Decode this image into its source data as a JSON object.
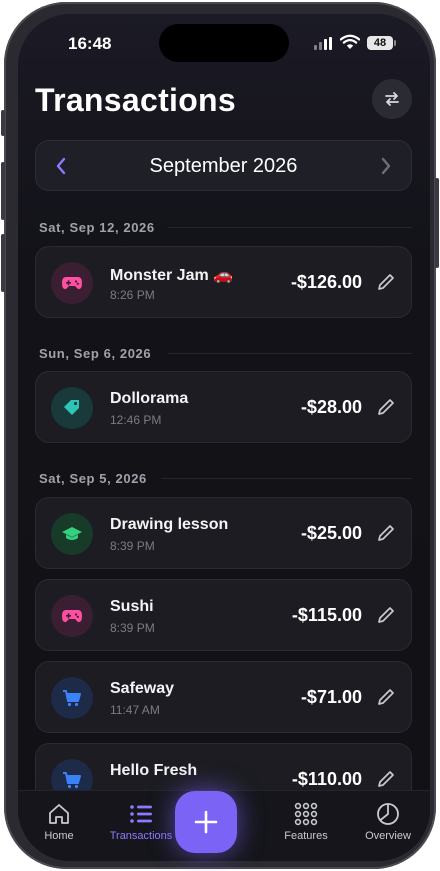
{
  "status": {
    "time": "16:48",
    "battery": "48"
  },
  "header": {
    "title": "Transactions"
  },
  "month_nav": {
    "label": "September 2026"
  },
  "groups": [
    {
      "date": "Sat, Sep 12, 2026",
      "items": [
        {
          "name": "Monster Jam 🚗",
          "time": "8:26 PM",
          "amount": "-$126.00",
          "icon": "gamepad-icon",
          "color": "#ff4fa3"
        }
      ]
    },
    {
      "date": "Sun, Sep 6, 2026",
      "items": [
        {
          "name": "Dollorama",
          "time": "12:46 PM",
          "amount": "-$28.00",
          "icon": "tag-icon",
          "color": "#2ec4b6"
        }
      ]
    },
    {
      "date": "Sat, Sep 5, 2026",
      "items": [
        {
          "name": "Drawing lesson",
          "time": "8:39 PM",
          "amount": "-$25.00",
          "icon": "graduation-cap-icon",
          "color": "#35d07f"
        },
        {
          "name": "Sushi",
          "time": "8:39 PM",
          "amount": "-$115.00",
          "icon": "gamepad-icon",
          "color": "#ff4fa3"
        },
        {
          "name": "Safeway",
          "time": "11:47 AM",
          "amount": "-$71.00",
          "icon": "cart-icon",
          "color": "#3b82f6"
        },
        {
          "name": "Hello Fresh",
          "time": "",
          "amount": "-$110.00",
          "icon": "cart-icon",
          "color": "#3b82f6"
        }
      ]
    }
  ],
  "tabs": [
    {
      "label": "Home",
      "icon": "home-icon",
      "active": false
    },
    {
      "label": "Transactions",
      "icon": "list-icon",
      "active": true
    },
    {
      "label": "Features",
      "icon": "grid-icon",
      "active": false
    },
    {
      "label": "Overview",
      "icon": "pie-chart-icon",
      "active": false
    }
  ],
  "colors": {
    "accent": "#7a63f5",
    "background": "#121218",
    "card": "#1c1c22"
  }
}
